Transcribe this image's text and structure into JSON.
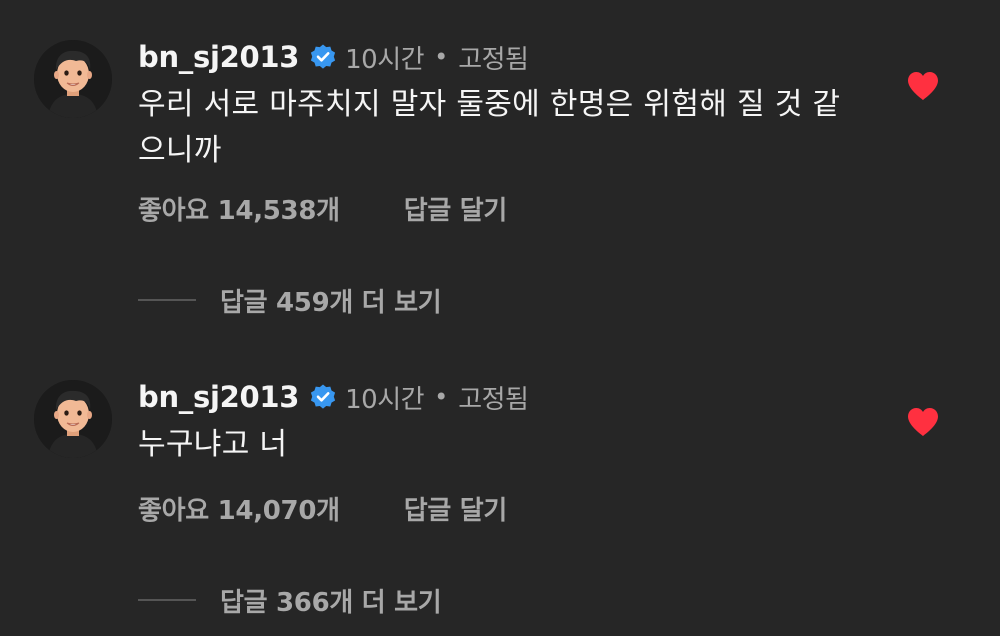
{
  "colors": {
    "background": "#262626",
    "primary_text": "#f5f5f5",
    "secondary_text": "#a8a8a8",
    "verified_badge": "#3897f0",
    "liked_heart": "#ff3040"
  },
  "comments": [
    {
      "username": "bn_sj2013",
      "verified_icon": "verified-badge-icon",
      "time": "10시간",
      "separator": "•",
      "pinned_label": "고정됨",
      "text": "우리 서로 마주치지 말자 둘중에 한명은 위험해 질 것 같으니까",
      "likes_label": "좋아요 14,538개",
      "reply_label": "답글 달기",
      "liked": true,
      "heart_icon": "heart-filled-icon",
      "view_replies_label": "답글 459개 더 보기"
    },
    {
      "username": "bn_sj2013",
      "verified_icon": "verified-badge-icon",
      "time": "10시간",
      "separator": "•",
      "pinned_label": "고정됨",
      "text": "누구냐고 너",
      "likes_label": "좋아요 14,070개",
      "reply_label": "답글 달기",
      "liked": true,
      "heart_icon": "heart-filled-icon",
      "view_replies_label": "답글 366개 더 보기"
    }
  ]
}
